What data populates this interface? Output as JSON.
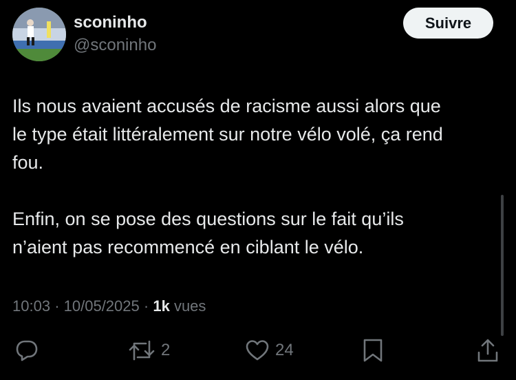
{
  "author": {
    "name": "sconinho",
    "handle": "@sconinho"
  },
  "follow_button": {
    "label": "Suivre"
  },
  "tweet": {
    "paragraphs": [
      "Ils nous avaient accusés de racisme aussi alors que\nle type était littéralement sur notre vélo volé, ça rend\nfou.",
      "Enfin, on se pose des questions sur le fait qu’ils\nn’aient pas recommencé en ciblant le vélo."
    ]
  },
  "meta": {
    "time": "10:03",
    "separator": "·",
    "date": "10/05/2025",
    "views_count": "1k",
    "views_label": "vues"
  },
  "actions": {
    "reply": {
      "icon": "reply-icon"
    },
    "retweet": {
      "icon": "retweet-icon",
      "count": "2"
    },
    "like": {
      "icon": "heart-icon",
      "count": "24"
    },
    "bookmark": {
      "icon": "bookmark-icon"
    },
    "share": {
      "icon": "share-icon"
    }
  },
  "colors": {
    "background": "#000000",
    "primary_text": "#e7e9ea",
    "secondary_text": "#71767b",
    "follow_button_bg": "#eff3f4",
    "follow_button_text": "#0f1419"
  }
}
